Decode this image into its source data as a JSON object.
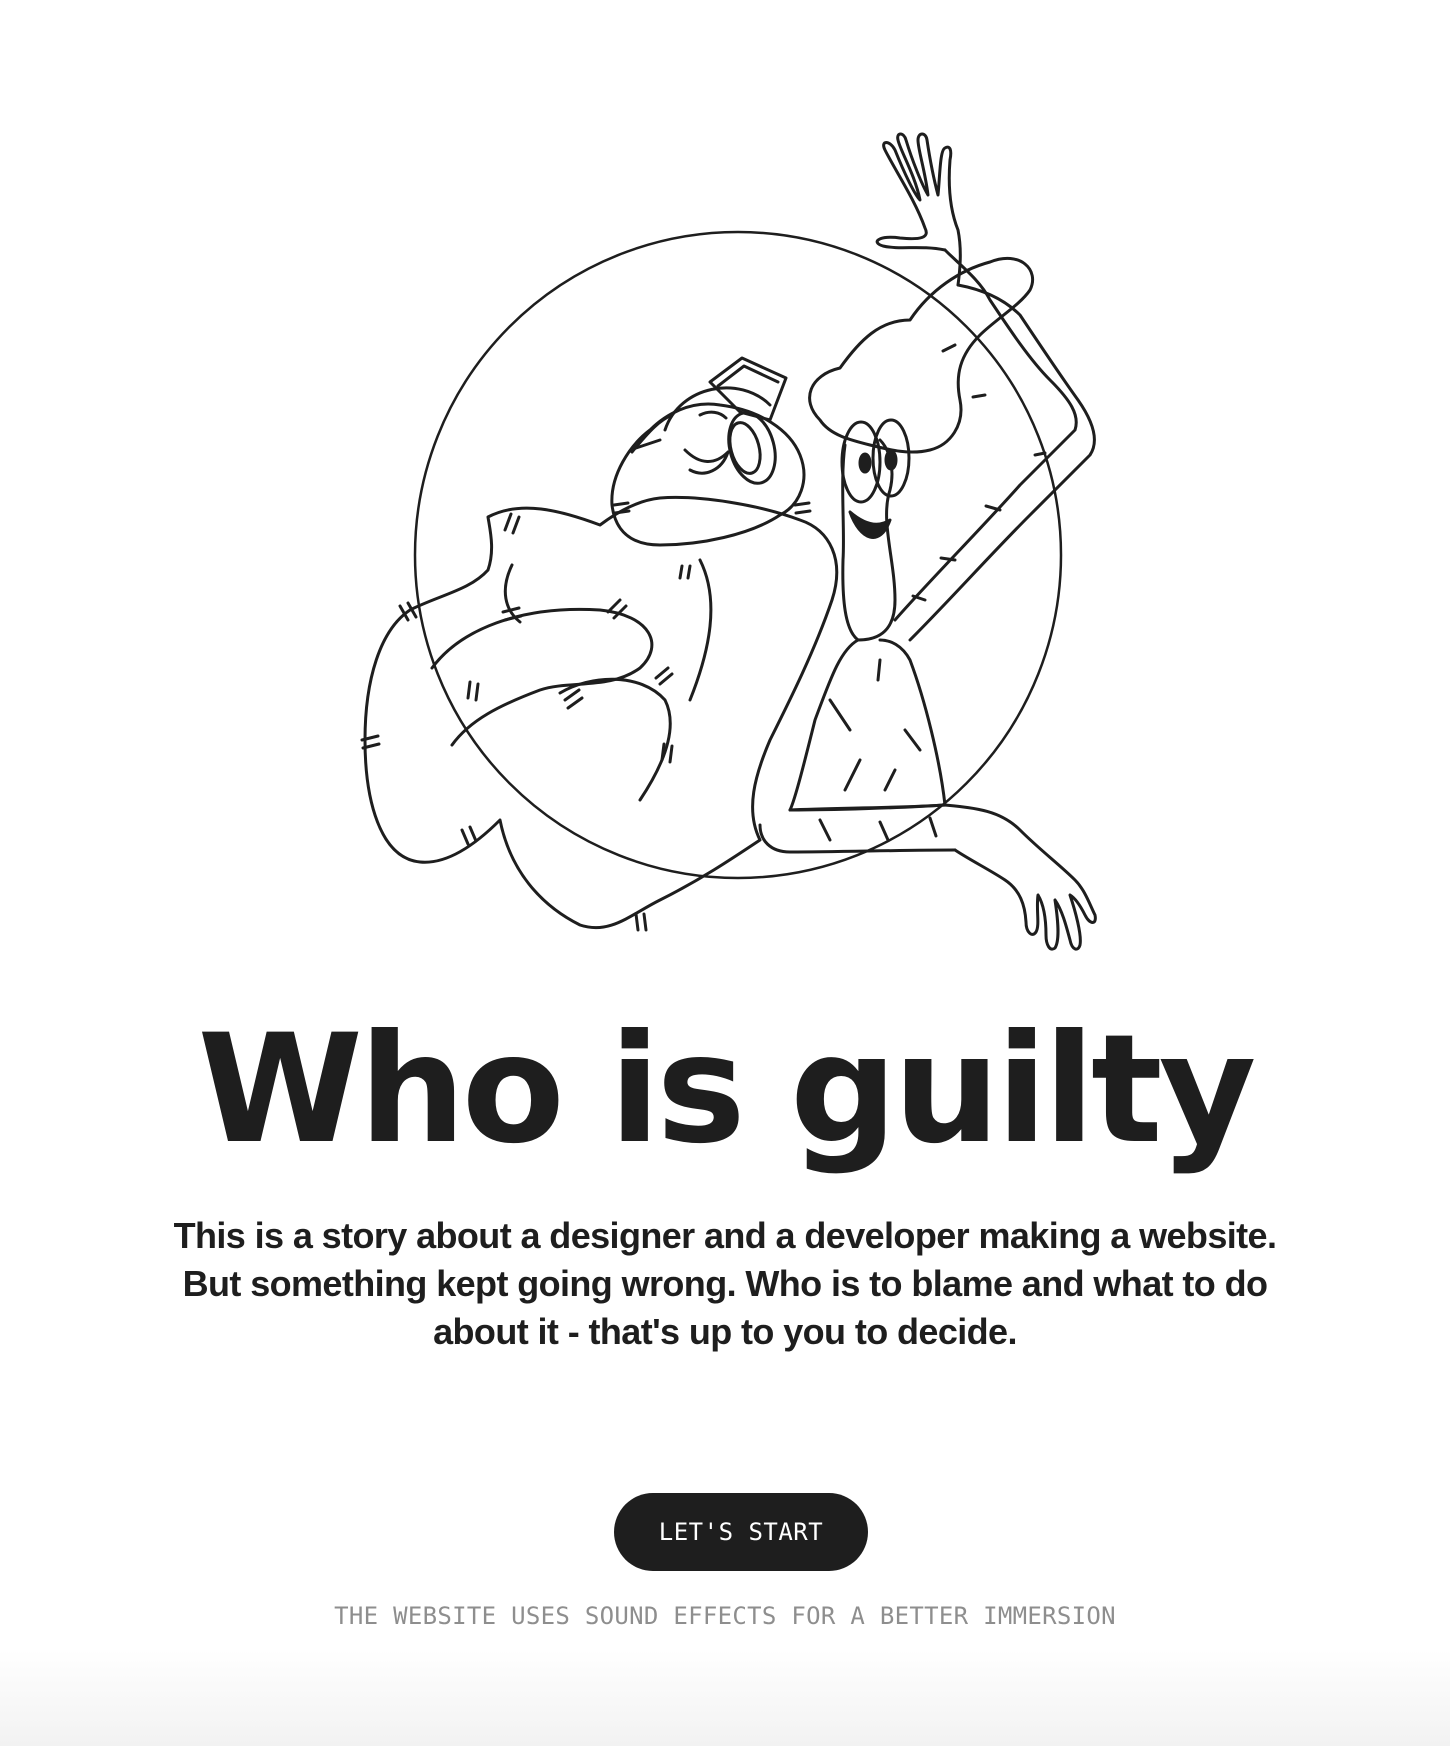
{
  "hero": {
    "illustration": "designer-and-developer-line-art",
    "title": "Who is guilty",
    "description": "This is a story about a designer and a developer making a website. But something kept going wrong. Who is to blame and what to do about it - that's up to you to decide."
  },
  "cta": {
    "label": "LET'S START"
  },
  "footer": {
    "sound_note": "THE WEBSITE USES SOUND EFFECTS FOR A BETTER IMMERSION"
  },
  "colors": {
    "background": "#ffffff",
    "ink": "#1e1e1e",
    "muted": "#8e8e8e",
    "button_text": "#ffffff"
  }
}
